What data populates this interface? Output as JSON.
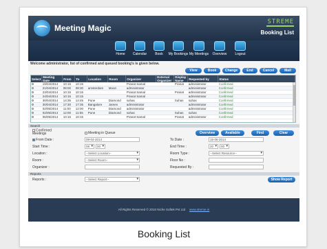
{
  "app": {
    "name": "Meeting Magic",
    "brand": "STREME",
    "page_label": "Booking List"
  },
  "nav": [
    {
      "label": "Home",
      "icon": "home-icon"
    },
    {
      "label": "Calendar",
      "icon": "calendar-icon"
    },
    {
      "label": "Book",
      "icon": "book-icon"
    },
    {
      "label": "My Bookings",
      "icon": "my-bookings-icon"
    },
    {
      "label": "My Meetings",
      "icon": "my-meetings-icon"
    },
    {
      "label": "Overview",
      "icon": "overview-icon"
    },
    {
      "label": "Logout",
      "icon": "logout-icon"
    }
  ],
  "welcome": "Welcome administrator, list of confirmed and queued booking's is given below.",
  "actions": {
    "view": "View",
    "book": "Book",
    "change": "Change",
    "end": "End",
    "cancel": "Cancel",
    "mail": "Mail"
  },
  "table": {
    "headers": [
      "Select",
      "Meeting Date",
      "From",
      "To",
      "Location",
      "Room",
      "Organizer",
      "External Organizer",
      "Display Name",
      "Requested by",
      "Status"
    ],
    "rows": [
      [
        "19/04/2014",
        "10:15",
        "10:15",
        "",
        "",
        "Pranat Samal",
        "",
        "Pranat",
        "administrator",
        "Confirmed"
      ],
      [
        "21/04/2014",
        "08:00",
        "08:30",
        "amsterdam",
        "Moon",
        "administrator",
        "",
        "",
        "administrator",
        "Confirmed"
      ],
      [
        "23/04/2014",
        "10:15",
        "10:15",
        "",
        "",
        "Pranat Samal",
        "",
        "Pranat",
        "administrator",
        "Confirmed"
      ],
      [
        "24/04/2014",
        "10:15",
        "10:15",
        "",
        "",
        "Pranat Samal",
        "",
        "",
        "administrator",
        "Confirmed"
      ],
      [
        "30/04/2014",
        "14:35",
        "14:45",
        "Pune",
        "Diamond",
        "suhas",
        "",
        "Suhas",
        "suhas",
        "Confirmed"
      ],
      [
        "30/04/2014",
        "17:30",
        "17:35",
        "Bangalore",
        "James",
        "administrator",
        "",
        "",
        "administrator",
        "Confirmed"
      ],
      [
        "02/05/2014",
        "11:00",
        "12:00",
        "Pune",
        "Diamond",
        "administrator",
        "",
        "",
        "administrator",
        "Confirmed"
      ],
      [
        "02/05/2014",
        "12:00",
        "11:55",
        "Pune",
        "Diamond",
        "suhas",
        "",
        "Suhas",
        "suhas",
        "Confirmed"
      ],
      [
        "06/05/2014",
        "10:15",
        "10:15",
        "",
        "",
        "Pranat Samal",
        "",
        "Pranat",
        "administrator",
        "Confirmed"
      ]
    ]
  },
  "search": {
    "section_label": "Search",
    "confirmed_meetings": "Confirmed Meetings",
    "meeting_in_queue": "Meeting in Queue",
    "from_date_label": "From Date :",
    "from_date_value": "09-04-2014",
    "to_date_label": "To Date :",
    "to_date_value": "16-06-2014",
    "start_time_label": "Start Time :",
    "start_hour": "08",
    "start_min": "00",
    "end_time_label": "End Time :",
    "end_hour": "20",
    "end_min": "00",
    "location_label": "Location :",
    "location_value": "--Select Location--",
    "room_type_label": "Room Type :",
    "room_type_value": "--Select Resource--",
    "room_label": "Room :",
    "room_value": "--Select Room--",
    "floor_label": "Floor No :",
    "organizer_label": "Organizer :",
    "requested_by_label": "Requested By :",
    "buttons": {
      "overview": "Overview",
      "available": "Available",
      "find": "Find",
      "clear": "Clear"
    }
  },
  "reports": {
    "section_label": "Reports",
    "label": "Reports :",
    "select_value": "--Select Report--",
    "show_button": "Show Report"
  },
  "footer": {
    "text": "All Rights Reserved © 2010 Niche Softek Pvt Ltd",
    "link": "www.streme.in"
  },
  "caption": "Booking List"
}
